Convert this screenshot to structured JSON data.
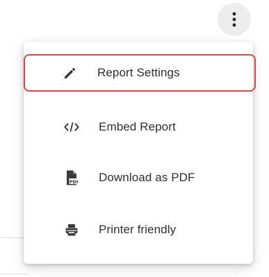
{
  "toolbar": {
    "more_button_icon": "more-vertical-icon"
  },
  "menu": {
    "items": [
      {
        "label": "Report Settings",
        "icon": "pencil-icon",
        "selected": true
      },
      {
        "label": "Embed Report",
        "icon": "code-icon",
        "selected": false
      },
      {
        "label": "Download as PDF",
        "icon": "pdf-file-icon",
        "selected": false
      },
      {
        "label": "Printer friendly",
        "icon": "printer-icon",
        "selected": false
      }
    ],
    "pdf_icon_text": "PDF"
  },
  "colors": {
    "selected_border": "#d9424b",
    "icon": "#3a3a3a",
    "text": "#2f2f2f"
  }
}
